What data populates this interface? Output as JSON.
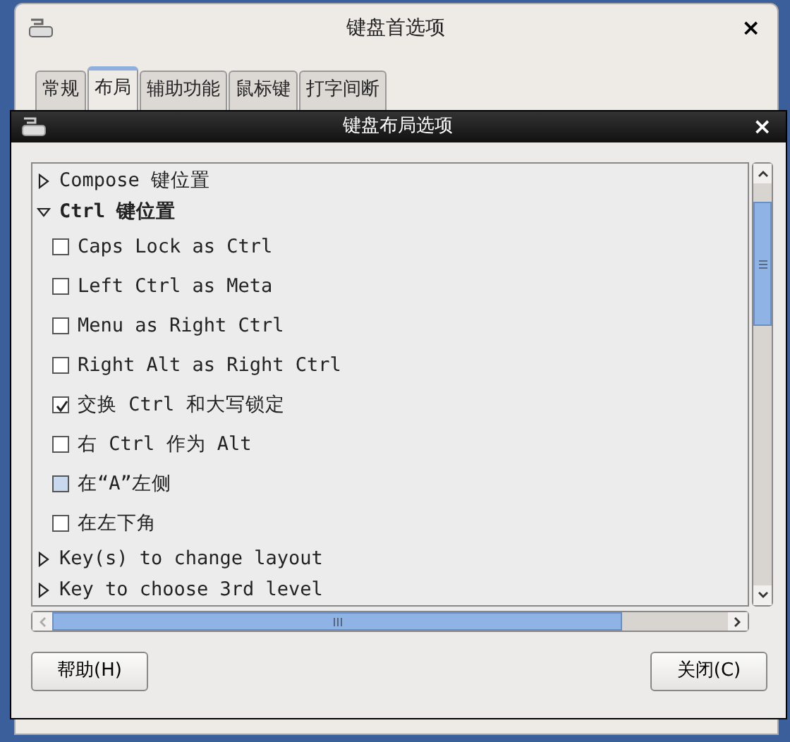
{
  "back_window": {
    "title": "键盘首选项",
    "close": "×",
    "tabs": [
      {
        "label": "常规",
        "selected": false
      },
      {
        "label": "布局",
        "selected": true
      },
      {
        "label": "辅助功能",
        "selected": false
      },
      {
        "label": "鼠标键",
        "selected": false
      },
      {
        "label": "打字间断",
        "selected": false
      }
    ]
  },
  "dialog": {
    "title": "键盘布局选项",
    "close": "×",
    "tree": [
      {
        "kind": "group",
        "label": "Compose 键位置",
        "expanded": false
      },
      {
        "kind": "group",
        "label": "Ctrl 键位置",
        "expanded": true,
        "children": [
          {
            "kind": "option",
            "label": "Caps Lock as Ctrl",
            "checked": false,
            "color": "#ffffff"
          },
          {
            "kind": "option",
            "label": "Left Ctrl as Meta",
            "checked": false,
            "color": "#ffffff"
          },
          {
            "kind": "option",
            "label": "Menu as Right Ctrl",
            "checked": false,
            "color": "#ffffff"
          },
          {
            "kind": "option",
            "label": "Right Alt as Right Ctrl",
            "checked": false,
            "color": "#ffffff"
          },
          {
            "kind": "option",
            "label": "交换 Ctrl 和大写锁定",
            "checked": true,
            "color": "#ffffff"
          },
          {
            "kind": "option",
            "label": "右 Ctrl 作为 Alt",
            "checked": false,
            "color": "#ffffff"
          },
          {
            "kind": "option",
            "label": "在“A”左侧",
            "checked": false,
            "color": "#c8d8ee"
          },
          {
            "kind": "option",
            "label": "在左下角",
            "checked": false,
            "color": "#ffffff"
          }
        ]
      },
      {
        "kind": "group",
        "label": "Key(s) to change layout",
        "expanded": false
      },
      {
        "kind": "group",
        "label": "Key to choose 3rd level",
        "expanded": false
      }
    ],
    "buttons": [
      "帮助(H)",
      "关闭(C)"
    ]
  }
}
